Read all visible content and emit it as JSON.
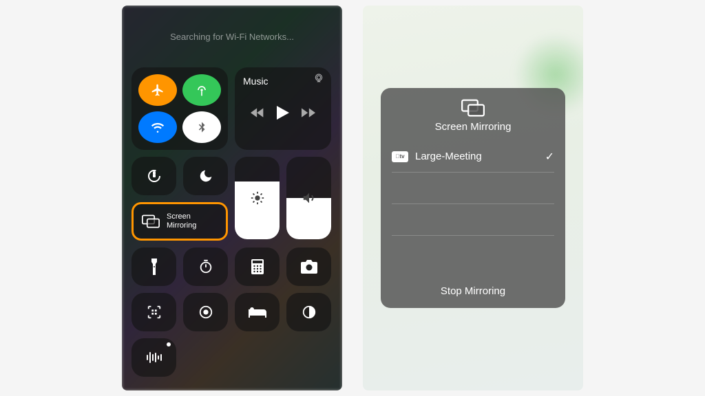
{
  "status_text": "Searching for Wi-Fi Networks...",
  "music": {
    "label": "Music"
  },
  "screen_mirror": {
    "label_line1": "Screen",
    "label_line2": "Mirroring"
  },
  "brightness_fill_pct": 70,
  "volume_fill_pct": 50,
  "modal": {
    "title": "Screen Mirroring",
    "device": "Large-Meeting",
    "tv_badge": "tv",
    "stop": "Stop Mirroring"
  }
}
